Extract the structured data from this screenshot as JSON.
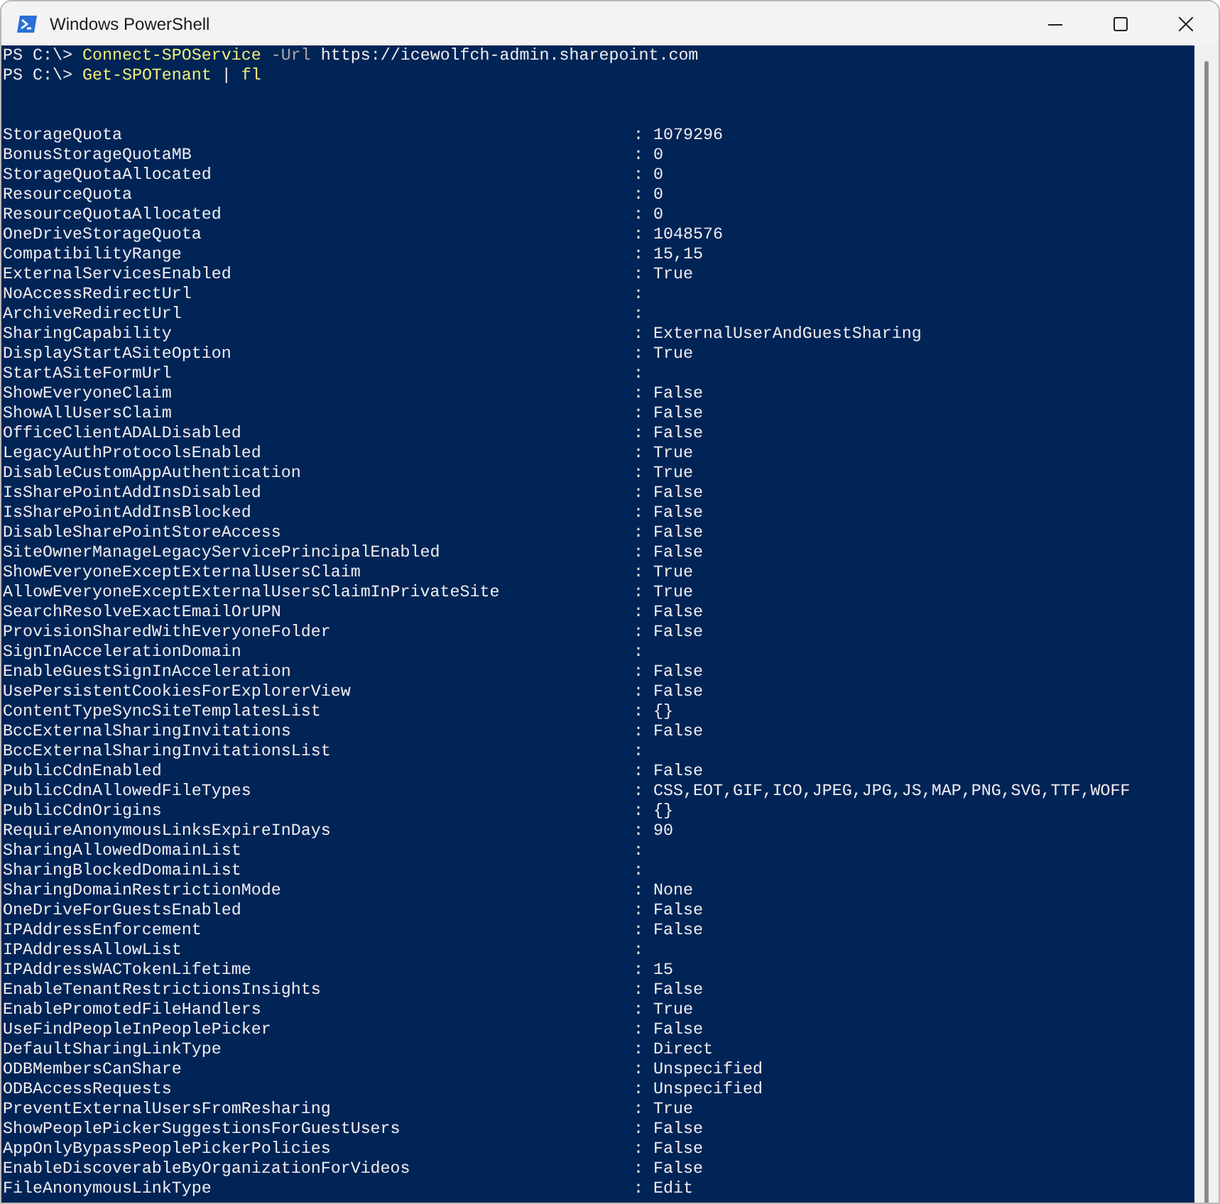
{
  "window": {
    "title": "Windows PowerShell"
  },
  "commands": [
    {
      "tokens": [
        {
          "kind": "prompt",
          "text": "PS C:\\>"
        },
        {
          "kind": "command",
          "text": "Connect-SPOService"
        },
        {
          "kind": "parameter",
          "text": "-Url"
        },
        {
          "kind": "argument",
          "text": "https://icewolfch-admin.sharepoint.com"
        }
      ]
    },
    {
      "tokens": [
        {
          "kind": "prompt",
          "text": "PS C:\\>"
        },
        {
          "kind": "command",
          "text": "Get-SPOTenant"
        },
        {
          "kind": "operator",
          "text": "|"
        },
        {
          "kind": "command",
          "text": "fl"
        }
      ]
    }
  ],
  "properties": [
    {
      "name": "StorageQuota",
      "value": ": 1079296"
    },
    {
      "name": "BonusStorageQuotaMB",
      "value": ": 0"
    },
    {
      "name": "StorageQuotaAllocated",
      "value": ": 0"
    },
    {
      "name": "ResourceQuota",
      "value": ": 0"
    },
    {
      "name": "ResourceQuotaAllocated",
      "value": ": 0"
    },
    {
      "name": "OneDriveStorageQuota",
      "value": ": 1048576"
    },
    {
      "name": "CompatibilityRange",
      "value": ": 15,15"
    },
    {
      "name": "ExternalServicesEnabled",
      "value": ": True"
    },
    {
      "name": "NoAccessRedirectUrl",
      "value": ":"
    },
    {
      "name": "ArchiveRedirectUrl",
      "value": ":"
    },
    {
      "name": "SharingCapability",
      "value": ": ExternalUserAndGuestSharing"
    },
    {
      "name": "DisplayStartASiteOption",
      "value": ": True"
    },
    {
      "name": "StartASiteFormUrl",
      "value": ":"
    },
    {
      "name": "ShowEveryoneClaim",
      "value": ": False"
    },
    {
      "name": "ShowAllUsersClaim",
      "value": ": False"
    },
    {
      "name": "OfficeClientADALDisabled",
      "value": ": False"
    },
    {
      "name": "LegacyAuthProtocolsEnabled",
      "value": ": True"
    },
    {
      "name": "DisableCustomAppAuthentication",
      "value": ": True"
    },
    {
      "name": "IsSharePointAddInsDisabled",
      "value": ": False"
    },
    {
      "name": "IsSharePointAddInsBlocked",
      "value": ": False"
    },
    {
      "name": "DisableSharePointStoreAccess",
      "value": ": False"
    },
    {
      "name": "SiteOwnerManageLegacyServicePrincipalEnabled",
      "value": ": False"
    },
    {
      "name": "ShowEveryoneExceptExternalUsersClaim",
      "value": ": True"
    },
    {
      "name": "AllowEveryoneExceptExternalUsersClaimInPrivateSite",
      "value": ": True"
    },
    {
      "name": "SearchResolveExactEmailOrUPN",
      "value": ": False"
    },
    {
      "name": "ProvisionSharedWithEveryoneFolder",
      "value": ": False"
    },
    {
      "name": "SignInAccelerationDomain",
      "value": ":"
    },
    {
      "name": "EnableGuestSignInAcceleration",
      "value": ": False"
    },
    {
      "name": "UsePersistentCookiesForExplorerView",
      "value": ": False"
    },
    {
      "name": "ContentTypeSyncSiteTemplatesList",
      "value": ": {}"
    },
    {
      "name": "BccExternalSharingInvitations",
      "value": ": False"
    },
    {
      "name": "BccExternalSharingInvitationsList",
      "value": ":"
    },
    {
      "name": "PublicCdnEnabled",
      "value": ": False"
    },
    {
      "name": "PublicCdnAllowedFileTypes",
      "value": ": CSS,EOT,GIF,ICO,JPEG,JPG,JS,MAP,PNG,SVG,TTF,WOFF"
    },
    {
      "name": "PublicCdnOrigins",
      "value": ": {}"
    },
    {
      "name": "RequireAnonymousLinksExpireInDays",
      "value": ": 90"
    },
    {
      "name": "SharingAllowedDomainList",
      "value": ":"
    },
    {
      "name": "SharingBlockedDomainList",
      "value": ":"
    },
    {
      "name": "SharingDomainRestrictionMode",
      "value": ": None"
    },
    {
      "name": "OneDriveForGuestsEnabled",
      "value": ": False"
    },
    {
      "name": "IPAddressEnforcement",
      "value": ": False"
    },
    {
      "name": "IPAddressAllowList",
      "value": ":"
    },
    {
      "name": "IPAddressWACTokenLifetime",
      "value": ": 15"
    },
    {
      "name": "EnableTenantRestrictionsInsights",
      "value": ": False"
    },
    {
      "name": "EnablePromotedFileHandlers",
      "value": ": True"
    },
    {
      "name": "UseFindPeopleInPeoplePicker",
      "value": ": False"
    },
    {
      "name": "DefaultSharingLinkType",
      "value": ": Direct"
    },
    {
      "name": "ODBMembersCanShare",
      "value": ": Unspecified"
    },
    {
      "name": "ODBAccessRequests",
      "value": ": Unspecified"
    },
    {
      "name": "PreventExternalUsersFromResharing",
      "value": ": True"
    },
    {
      "name": "ShowPeoplePickerSuggestionsForGuestUsers",
      "value": ": False"
    },
    {
      "name": "AppOnlyBypassPeoplePickerPolicies",
      "value": ": False"
    },
    {
      "name": "EnableDiscoverableByOrganizationForVideos",
      "value": ": False"
    },
    {
      "name": "FileAnonymousLinkType",
      "value": ": Edit"
    }
  ]
}
